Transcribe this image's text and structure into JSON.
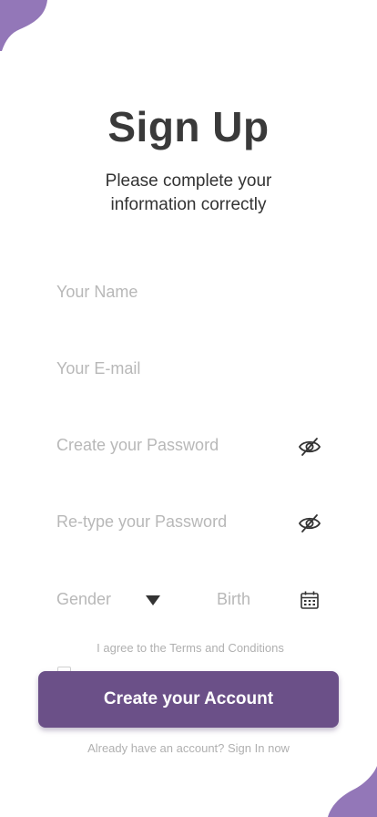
{
  "header": {
    "title": "Sign Up",
    "subtitle_line1": "Please complete your",
    "subtitle_line2": "information correctly"
  },
  "form": {
    "name": {
      "value": "",
      "placeholder": "Your Name"
    },
    "email": {
      "value": "",
      "placeholder": "Your E-mail"
    },
    "password": {
      "value": "",
      "placeholder": "Create your Password",
      "icon": "eye-slash-icon"
    },
    "retype_password": {
      "value": "",
      "placeholder": "Re-type your Password",
      "icon": "eye-slash-icon"
    },
    "gender": {
      "label": "Gender",
      "icon": "caret-down-icon"
    },
    "birth": {
      "label": "Birth",
      "icon": "calendar-icon"
    },
    "terms": {
      "text": "I agree to the Terms and Conditions",
      "checked": false
    }
  },
  "actions": {
    "create_label": "Create your Account",
    "signin_text": "Already have an account? Sign In now"
  },
  "colors": {
    "accent": "#6b5088",
    "blob": "#9377b8",
    "title": "#3a3a3a",
    "placeholder": "#b8b8b8"
  }
}
